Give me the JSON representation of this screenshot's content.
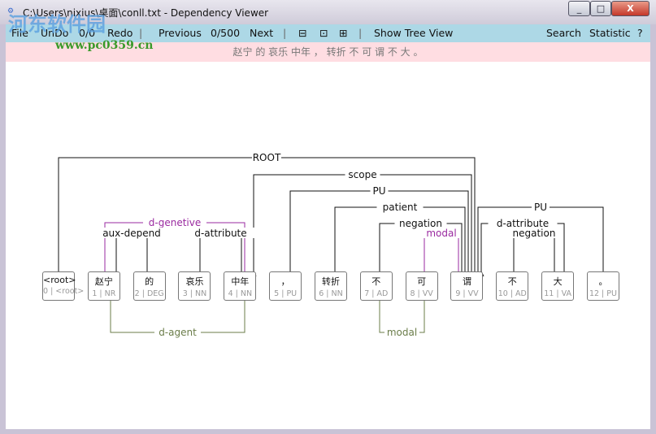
{
  "window": {
    "title": "C:\\Users\\nixius\\桌面\\conll.txt - Dependency Viewer",
    "controls": [
      "_",
      "□",
      "X"
    ]
  },
  "watermark": {
    "cn": "河东软件园",
    "url": "www.pc0359.cn"
  },
  "toolbar": {
    "file": "File",
    "undo": "UnDo",
    "undo_count": "0/0",
    "redo": "Redo",
    "previous": "Previous",
    "position": "0/500",
    "next": "Next",
    "zoom_out": "⊟",
    "zoom_reset": "⊡",
    "zoom_in": "⊞",
    "show_tree": "Show Tree View",
    "search": "Search",
    "statistic": "Statistic",
    "help": "?"
  },
  "sentence": "赵宁 的 哀乐 中年 ， 转折 不 可 谓 不 大 。",
  "colors": {
    "default": "#111111",
    "purple": "#9a2aa0",
    "olive": "#6b7d4a",
    "toolbar": "#add8e6",
    "sentence_bg": "#ffdde2"
  },
  "tokens": [
    {
      "word": "<root>",
      "tag": "0 | <root>"
    },
    {
      "word": "赵宁",
      "tag": "1 | NR"
    },
    {
      "word": "的",
      "tag": "2 | DEG"
    },
    {
      "word": "哀乐",
      "tag": "3 | NN"
    },
    {
      "word": "中年",
      "tag": "4 | NN"
    },
    {
      "word": "，",
      "tag": "5 | PU"
    },
    {
      "word": "转折",
      "tag": "6 | NN"
    },
    {
      "word": "不",
      "tag": "7 | AD"
    },
    {
      "word": "可",
      "tag": "8 | VV"
    },
    {
      "word": "谓",
      "tag": "9 | VV"
    },
    {
      "word": "不",
      "tag": "10 | AD"
    },
    {
      "word": "大",
      "tag": "11 | VA"
    },
    {
      "word": "。",
      "tag": "12 | PU"
    }
  ],
  "arcs": [
    {
      "from": 9,
      "to": 0,
      "label": "ROOT",
      "color": "default",
      "side": "above"
    },
    {
      "from": 9,
      "to": 4,
      "label": "scope",
      "color": "default",
      "side": "above"
    },
    {
      "from": 9,
      "to": 5,
      "label": "PU",
      "color": "default",
      "side": "above"
    },
    {
      "from": 9,
      "to": 6,
      "label": "patient",
      "color": "default",
      "side": "above"
    },
    {
      "from": 9,
      "to": 7,
      "label": "negation",
      "color": "default",
      "side": "above"
    },
    {
      "from": 9,
      "to": 8,
      "label": "modal",
      "color": "purple",
      "side": "above"
    },
    {
      "from": 1,
      "to": 4,
      "label": "d-genetive",
      "color": "purple",
      "side": "above"
    },
    {
      "from": 2,
      "to": 1,
      "label": "aux-depend",
      "color": "default",
      "side": "above"
    },
    {
      "from": 3,
      "to": 4,
      "label": "d-attribute",
      "color": "default",
      "side": "above"
    },
    {
      "from": 12,
      "to": 9,
      "label": "PU",
      "color": "default",
      "side": "above"
    },
    {
      "from": 11,
      "to": 9,
      "label": "d-attribute",
      "color": "default",
      "side": "above"
    },
    {
      "from": 10,
      "to": 11,
      "label": "negation",
      "color": "default",
      "side": "above"
    },
    {
      "from": 1,
      "to": 4,
      "label": "d-agent",
      "color": "olive",
      "side": "below"
    },
    {
      "from": 8,
      "to": 7,
      "label": "modal",
      "color": "olive",
      "side": "below"
    }
  ]
}
